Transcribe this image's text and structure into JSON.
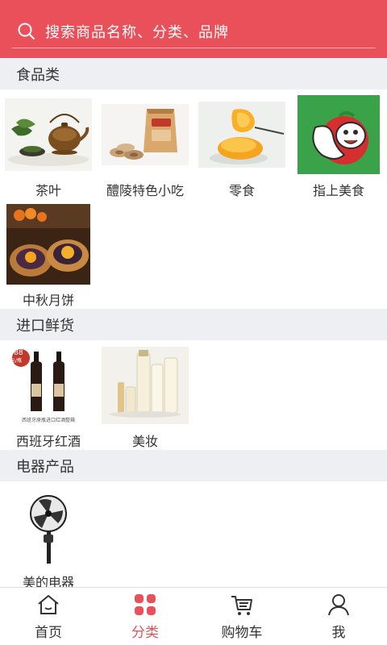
{
  "colors": {
    "accent": "#e9505a",
    "section_bg": "#eeeff3"
  },
  "search": {
    "placeholder": "搜索商品名称、分类、品牌",
    "icon": "search-icon"
  },
  "sections": [
    {
      "title": "食品类",
      "items": [
        {
          "label": "茶叶",
          "icon": "teapot"
        },
        {
          "label": "醴陵特色小吃",
          "icon": "snack-package"
        },
        {
          "label": "零食",
          "icon": "peach-slices"
        },
        {
          "label": "指上美食",
          "icon": "cartoon-logo"
        },
        {
          "label": "中秋月饼",
          "icon": "mooncake"
        }
      ]
    },
    {
      "title": "进口鲜货",
      "items": [
        {
          "label": "西班牙红酒",
          "icon": "wine-bottles",
          "badge": "¥88",
          "badge_sub": "元/瓶",
          "caption": "西班牙原瓶进口红酒整箱"
        },
        {
          "label": "美妆",
          "icon": "cosmetics-bottles"
        }
      ]
    },
    {
      "title": "电器产品",
      "items": [
        {
          "label": "美的电器",
          "icon": "electric-fan"
        }
      ]
    }
  ],
  "nav": [
    {
      "label": "首页",
      "icon": "home-icon",
      "active": false
    },
    {
      "label": "分类",
      "icon": "category-icon",
      "active": true
    },
    {
      "label": "购物车",
      "icon": "cart-icon",
      "active": false
    },
    {
      "label": "我",
      "icon": "user-icon",
      "active": false
    }
  ]
}
